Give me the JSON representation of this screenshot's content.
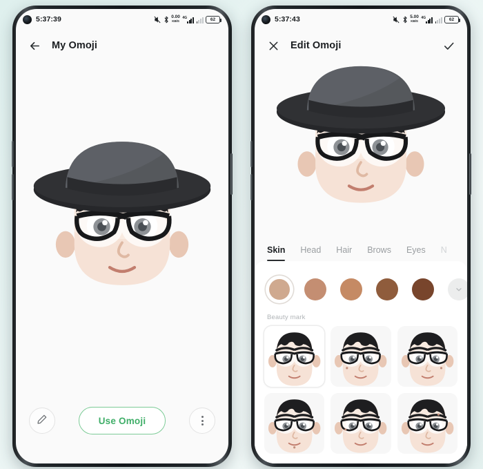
{
  "background_color": "#e4f1ef",
  "accent_green": "#3fae68",
  "phones": {
    "left": {
      "status_bar": {
        "time": "5:37:39",
        "net_speed_value": "0.00",
        "net_speed_unit": "KB/S",
        "network_tag": "4G",
        "battery_level": "62",
        "icons": [
          "mute-icon",
          "bluetooth-icon",
          "data-speed-icon",
          "sim1-signal-icon",
          "sim2-signal-icon",
          "battery-icon"
        ]
      },
      "app_bar": {
        "back_icon": "arrow-left-icon",
        "title": "My Omoji"
      },
      "actions": {
        "edit_icon": "pencil-icon",
        "primary_label": "Use Omoji",
        "more_icon": "more-vertical-icon"
      }
    },
    "right": {
      "status_bar": {
        "time": "5:37:43",
        "net_speed_value": "5.00",
        "net_speed_unit": "KB/S",
        "network_tag": "4G",
        "battery_level": "62",
        "icons": [
          "mute-icon",
          "bluetooth-icon",
          "data-speed-icon",
          "sim1-signal-icon",
          "sim2-signal-icon",
          "battery-icon"
        ]
      },
      "app_bar": {
        "close_icon": "close-icon",
        "title": "Edit Omoji",
        "confirm_icon": "check-icon"
      },
      "editor": {
        "tabs": [
          {
            "label": "Skin",
            "active": true
          },
          {
            "label": "Head",
            "active": false
          },
          {
            "label": "Hair",
            "active": false
          },
          {
            "label": "Brows",
            "active": false
          },
          {
            "label": "Eyes",
            "active": false
          },
          {
            "label": "N",
            "active": false,
            "cut_off": true
          }
        ],
        "skin_tones": [
          {
            "name": "tone-1",
            "color": "#cfa98f",
            "selected": true
          },
          {
            "name": "tone-2",
            "color": "#c48e72",
            "selected": false
          },
          {
            "name": "tone-3",
            "color": "#c58a64",
            "selected": false
          },
          {
            "name": "tone-4",
            "color": "#8f5c3c",
            "selected": false
          },
          {
            "name": "tone-5",
            "color": "#78452c",
            "selected": false
          }
        ],
        "more_tones_icon": "chevron-down-icon",
        "section_label": "Beauty mark",
        "beauty_marks": [
          {
            "name": "beauty-mark-none",
            "selected": true
          },
          {
            "name": "beauty-mark-left",
            "selected": false
          },
          {
            "name": "beauty-mark-right",
            "selected": false
          },
          {
            "name": "beauty-mark-chin",
            "selected": false
          },
          {
            "name": "beauty-mark-cheek",
            "selected": false
          },
          {
            "name": "beauty-mark-brow",
            "selected": false
          }
        ]
      }
    }
  }
}
